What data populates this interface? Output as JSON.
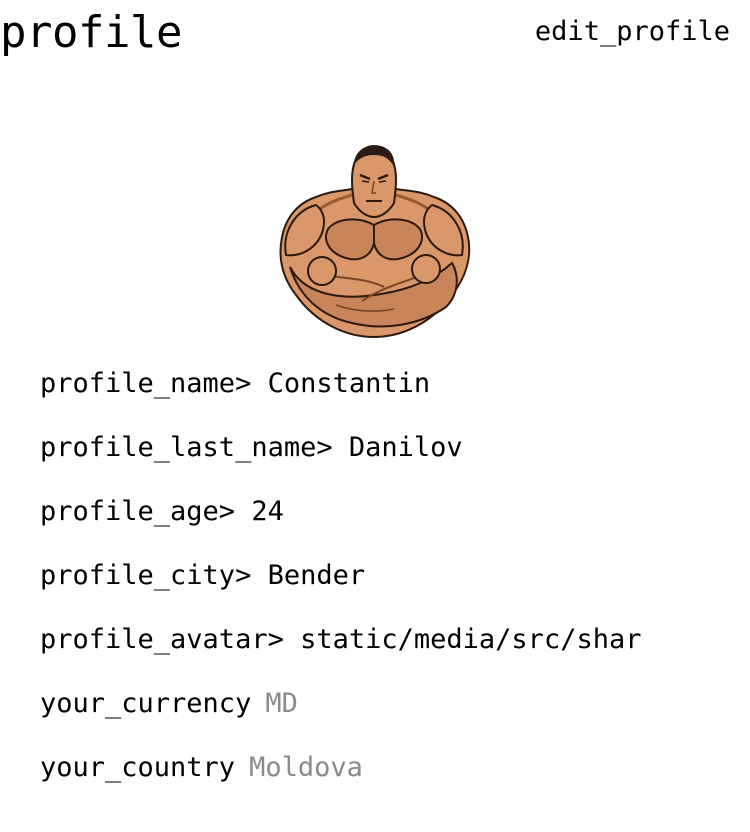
{
  "header": {
    "title": "profile",
    "edit_label": "edit_profile"
  },
  "avatar": {
    "icon": "bodybuilder-avatar-icon"
  },
  "fields": [
    {
      "label": "profile_name>",
      "value": "Constantin"
    },
    {
      "label": "profile_last_name>",
      "value": "Danilov"
    },
    {
      "label": "profile_age>",
      "value": "24"
    },
    {
      "label": "profile_city>",
      "value": "Bender"
    },
    {
      "label": "profile_avatar>",
      "value": "static/media/src/shar"
    }
  ],
  "extras": [
    {
      "label": "your_currency",
      "value": "MD"
    },
    {
      "label": "your_country",
      "value": "Moldova"
    }
  ],
  "colors": {
    "text": "#000000",
    "muted": "#8a8a8a",
    "skin": "#d9976a",
    "skin_shadow": "#9c5a34",
    "hair": "#2a1c14"
  }
}
